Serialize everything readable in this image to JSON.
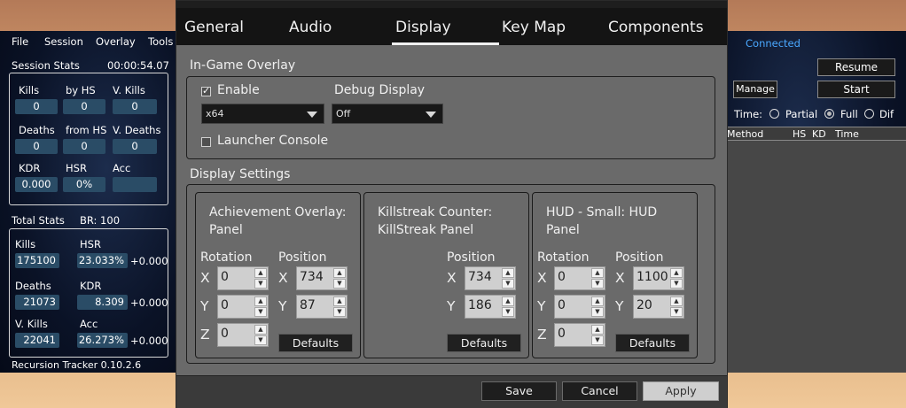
{
  "tracker": {
    "menu": [
      "File",
      "Session",
      "Overlay",
      "Tools"
    ],
    "session_label": "Session Stats",
    "session_time": "00:00:54.07",
    "session": {
      "kills_label": "Kills",
      "by_hs_label": "by HS",
      "v_kills_label": "V. Kills",
      "kills": "0",
      "by_hs": "0",
      "v_kills": "0",
      "deaths_label": "Deaths",
      "from_hs_label": "from HS",
      "v_deaths_label": "V. Deaths",
      "deaths": "0",
      "from_hs": "0",
      "v_deaths": "0",
      "kdr_label": "KDR",
      "hsr_label": "HSR",
      "acc_label": "Acc",
      "kdr": "0.000",
      "hsr": "0%",
      "acc": ""
    },
    "total_label": "Total Stats",
    "br": "BR: 100",
    "total": {
      "kills_label": "Kills",
      "kills": "175100",
      "hsr_label": "HSR",
      "hsr": "23.033%",
      "hsr_delta": "+0.000",
      "deaths_label": "Deaths",
      "deaths": "21073",
      "kdr_label": "KDR",
      "kdr": "8.309",
      "kdr_delta": "+0.000",
      "v_kills_label": "V. Kills",
      "v_kills": "22041",
      "acc_label": "Acc",
      "acc": "26.273%",
      "acc_delta": "+0.000"
    },
    "version": "Recursion Tracker 0.10.2.6"
  },
  "right_panel": {
    "status": "Connected",
    "status_color": "#4aa8ff",
    "resume_label": "Resume",
    "manage_label": "Manage",
    "start_label": "Start",
    "time_label": "Time:",
    "time_options": [
      "Partial",
      "Full",
      "Dif"
    ],
    "time_selected": "Full",
    "columns": [
      "Method",
      "HS",
      "KD",
      "Time"
    ]
  },
  "dialog": {
    "tabs": [
      "General",
      "Audio",
      "Display",
      "Key Map",
      "Components"
    ],
    "active_tab": "Display",
    "in_game_overlay": {
      "title": "In-Game Overlay",
      "enable_label": "Enable",
      "enable_checked": true,
      "arch_value": "x64",
      "debug_label": "Debug Display",
      "debug_value": "Off",
      "launcher_label": "Launcher Console",
      "launcher_checked": false
    },
    "display_settings": {
      "title": "Display Settings",
      "panels": [
        {
          "title": "Achievement Overlay: Panel",
          "rotation_label": "Rotation",
          "position_label": "Position",
          "rot": {
            "x": "0",
            "y": "0",
            "z": "0"
          },
          "pos": {
            "x": "734",
            "y": "87"
          },
          "defaults_label": "Defaults"
        },
        {
          "title": "Killstreak Counter: KillStreak Panel",
          "position_label": "Position",
          "pos": {
            "x": "734",
            "y": "186"
          },
          "defaults_label": "Defaults"
        },
        {
          "title": "HUD - Small: HUD Panel",
          "rotation_label": "Rotation",
          "position_label": "Position",
          "rot": {
            "x": "0",
            "y": "0",
            "z": "0"
          },
          "pos": {
            "x": "1100",
            "y": "20"
          },
          "defaults_label": "Defaults"
        }
      ],
      "axis": {
        "x": "X",
        "y": "Y",
        "z": "Z"
      }
    },
    "footer": {
      "save": "Save",
      "cancel": "Cancel",
      "apply": "Apply"
    }
  }
}
